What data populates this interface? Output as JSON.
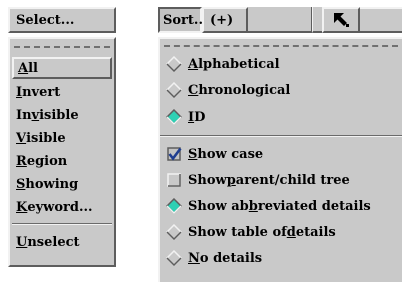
{
  "select_menu": {
    "button_label": "Select...",
    "items": [
      {
        "pre": "",
        "ul": "A",
        "post": "ll"
      },
      {
        "pre": "",
        "ul": "I",
        "post": "nvert"
      },
      {
        "pre": "In",
        "ul": "v",
        "post": "isible"
      },
      {
        "pre": "",
        "ul": "V",
        "post": "isible"
      },
      {
        "pre": "",
        "ul": "R",
        "post": "egion"
      },
      {
        "pre": "",
        "ul": "S",
        "post": "howing"
      },
      {
        "pre": "",
        "ul": "K",
        "post": "eyword..."
      }
    ],
    "unselect": {
      "pre": "",
      "ul": "U",
      "post": "nselect"
    }
  },
  "sort_menu": {
    "button_label": "Sort...",
    "plus_label": "(+)",
    "sort_options": [
      {
        "pre": "",
        "ul": "A",
        "post": "lphabetical",
        "selected": false
      },
      {
        "pre": "",
        "ul": "C",
        "post": "hronological",
        "selected": false
      },
      {
        "pre": "",
        "ul": "I",
        "post": "D",
        "selected": true
      }
    ],
    "checks": [
      {
        "pre": "",
        "ul": "S",
        "post": "how case",
        "checked": true
      },
      {
        "pre": "Show ",
        "ul": "p",
        "post": "arent/child tree",
        "checked": false
      }
    ],
    "detail_options": [
      {
        "pre": "Show ab",
        "ul": "b",
        "post": "reviated details",
        "selected": true
      },
      {
        "pre": "Show table of ",
        "ul": "d",
        "post": "etails",
        "selected": false
      },
      {
        "pre": "",
        "ul": "N",
        "post": "o details",
        "selected": false
      }
    ]
  },
  "colors": {
    "panel": "#c9c9c9",
    "highlight": "#f2f2f2",
    "shadow": "#5d5d5d",
    "radio_on": "#2fd0b4",
    "check_mark": "#1f3d8f"
  },
  "icons": {
    "pointer": "arrow-up-left-icon",
    "radio": "diamond-radio-icon",
    "check": "checkbox-icon"
  }
}
